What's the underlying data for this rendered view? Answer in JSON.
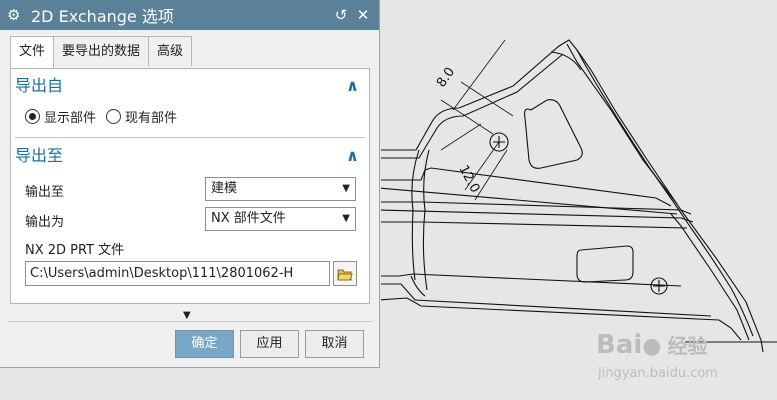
{
  "dialog": {
    "title": "2D Exchange 选项",
    "reset_label": "↺",
    "close_label": "✕",
    "tabs": [
      {
        "label": "文件",
        "active": true
      },
      {
        "label": "要导出的数据",
        "active": false
      },
      {
        "label": "高级",
        "active": false
      }
    ],
    "export_from": {
      "title": "导出自",
      "options": [
        {
          "label": "显示部件",
          "selected": true
        },
        {
          "label": "现有部件",
          "selected": false
        }
      ]
    },
    "export_to": {
      "title": "导出至",
      "output_to_label": "输出至",
      "output_to_value": "建模",
      "output_as_label": "输出为",
      "output_as_value": "NX 部件文件",
      "file_label": "NX 2D PRT 文件",
      "file_value": "C:\\Users\\admin\\Desktop\\111\\2801062-H"
    },
    "buttons": {
      "ok": "确定",
      "apply": "应用",
      "cancel": "取消"
    }
  },
  "cad": {
    "dim1": "8.0",
    "dim2": "12.0"
  },
  "watermark": {
    "brand": "Bai",
    "brand_suffix": "经验",
    "url": "jingyan.baidu.com"
  },
  "colors": {
    "titlebar": "#5b8199",
    "accent": "#1d6e9e",
    "primary_button": "#7aa7c7"
  }
}
